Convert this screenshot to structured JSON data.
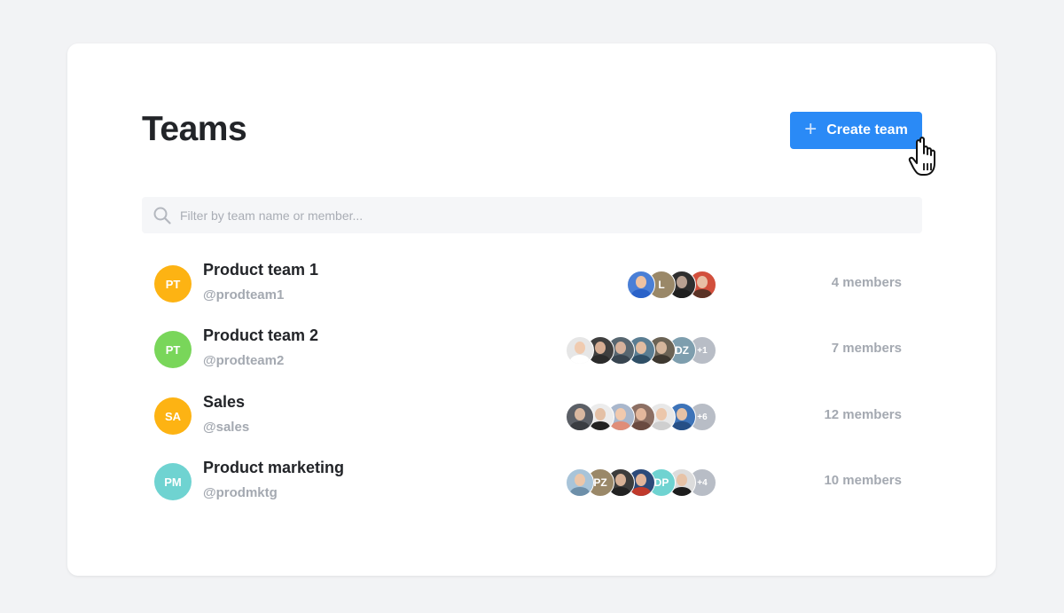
{
  "page": {
    "title": "Teams"
  },
  "actions": {
    "create_label": "Create team",
    "create_icon": "plus-icon"
  },
  "search": {
    "placeholder": "Filter by team name or member...",
    "value": "",
    "icon": "search-icon"
  },
  "colors": {
    "accent": "#2a8af6",
    "orange": "#fdb313",
    "green": "#79d65a",
    "teal": "#6fd3d1",
    "muted": "#a4a9b1"
  },
  "teams": [
    {
      "initials": "PT",
      "name": "Product team 1",
      "handle": "@prodteam1",
      "members_label": "4 members",
      "color": "#fdb313",
      "avatars": [
        {
          "type": "photo",
          "bg": "#4a7fd6",
          "skin": "#eec2a2",
          "shirt": "#2a62c9"
        },
        {
          "type": "initials",
          "text": "L",
          "bg": "#9a8868"
        },
        {
          "type": "photo",
          "bg": "#2f2f2f",
          "skin": "#b9a192",
          "shirt": "#1f1f1f"
        },
        {
          "type": "photo",
          "bg": "#d24f3c",
          "skin": "#e8bfa5",
          "shirt": "#5b3326"
        }
      ],
      "more": null
    },
    {
      "initials": "PT",
      "name": "Product team 2",
      "handle": "@prodteam2",
      "members_label": "7 members",
      "color": "#79d65a",
      "avatars": [
        {
          "type": "photo",
          "bg": "#e6e6e6",
          "skin": "#f0cbb0",
          "shirt": "#ffffff"
        },
        {
          "type": "photo",
          "bg": "#3f3f3f",
          "skin": "#d6ad93",
          "shirt": "#2b2b2b"
        },
        {
          "type": "photo",
          "bg": "#576670",
          "skin": "#d7b29c",
          "shirt": "#384550"
        },
        {
          "type": "photo",
          "bg": "#5a7d92",
          "skin": "#e1bca1",
          "shirt": "#2f4f66"
        },
        {
          "type": "photo",
          "bg": "#6b6355",
          "skin": "#d5b69c",
          "shirt": "#3d3830"
        },
        {
          "type": "initials",
          "text": "DZ",
          "bg": "#7e9eae"
        }
      ],
      "more": "+1"
    },
    {
      "initials": "SA",
      "name": "Sales",
      "handle": "@sales",
      "members_label": "12 members",
      "color": "#fdb313",
      "avatars": [
        {
          "type": "photo",
          "bg": "#5b5f66",
          "skin": "#d9b8a0",
          "shirt": "#3a3d42"
        },
        {
          "type": "photo",
          "bg": "#ececec",
          "skin": "#e4c0a5",
          "shirt": "#222222"
        },
        {
          "type": "photo",
          "bg": "#a9b7cc",
          "skin": "#f1c9ad",
          "shirt": "#e08d78"
        },
        {
          "type": "photo",
          "bg": "#8c6f63",
          "skin": "#e3b79c",
          "shirt": "#6a4a40"
        },
        {
          "type": "photo",
          "bg": "#e8e8e8",
          "skin": "#ecc7ab",
          "shirt": "#cfcfcf"
        },
        {
          "type": "photo",
          "bg": "#3d73b8",
          "skin": "#e6c2a6",
          "shirt": "#264f86"
        }
      ],
      "more": "+6"
    },
    {
      "initials": "PM",
      "name": "Product marketing",
      "handle": "@prodmktg",
      "members_label": "10 members",
      "color": "#6fd3d1",
      "avatars": [
        {
          "type": "photo",
          "bg": "#a8c4d9",
          "skin": "#ecc6a9",
          "shirt": "#6d8fa9"
        },
        {
          "type": "initials",
          "text": "PZ",
          "bg": "#9a8868"
        },
        {
          "type": "photo",
          "bg": "#3c3c3c",
          "skin": "#d6b096",
          "shirt": "#222222"
        },
        {
          "type": "photo",
          "bg": "#2c4a7a",
          "skin": "#e1b49a",
          "shirt": "#c0392b"
        },
        {
          "type": "initials",
          "text": "DP",
          "bg": "#6fd3d1"
        },
        {
          "type": "photo",
          "bg": "#dcdcdc",
          "skin": "#e7c3a7",
          "shirt": "#1d1d1d"
        }
      ],
      "more": "+4"
    }
  ]
}
